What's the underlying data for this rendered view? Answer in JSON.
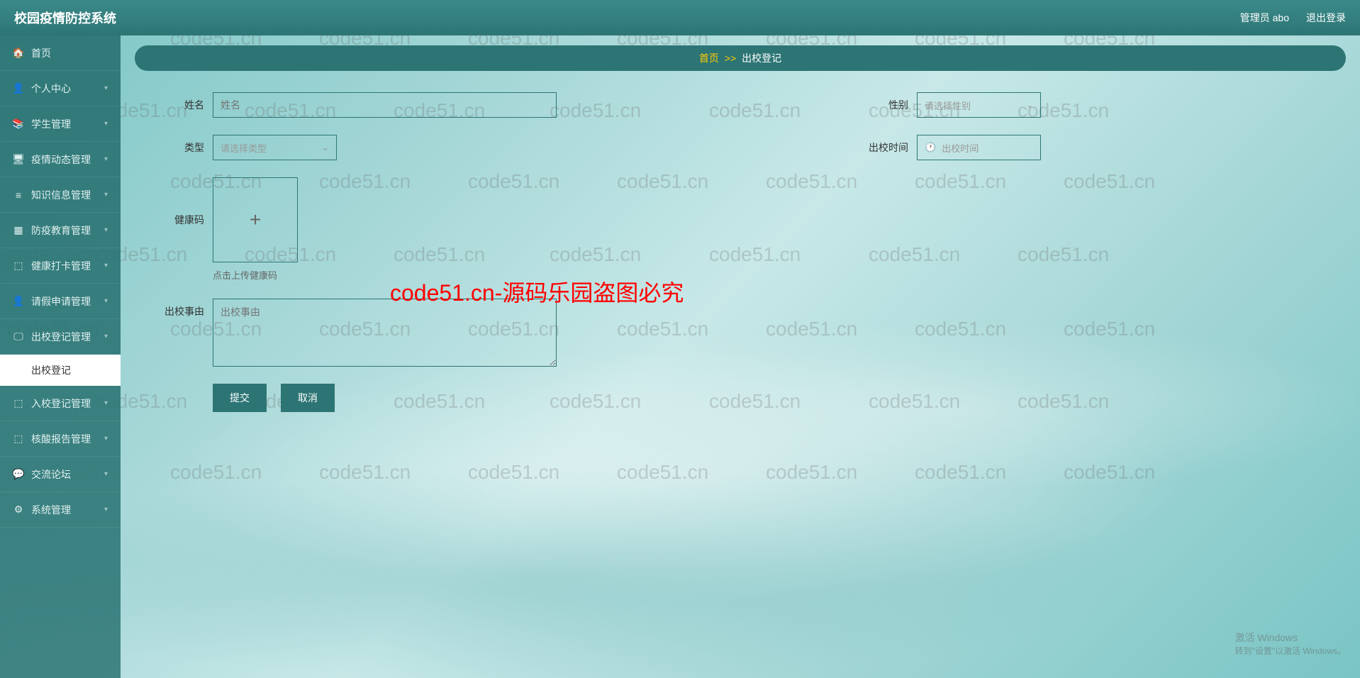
{
  "header": {
    "title": "校园疫情防控系统",
    "user_label": "管理员 abo",
    "logout": "退出登录"
  },
  "sidebar": {
    "items": [
      {
        "icon": "🏠",
        "label": "首页"
      },
      {
        "icon": "👤",
        "label": "个人中心"
      },
      {
        "icon": "📚",
        "label": "学生管理"
      },
      {
        "icon": "🖥",
        "label": "疫情动态管理"
      },
      {
        "icon": "≡",
        "label": "知识信息管理"
      },
      {
        "icon": "▦",
        "label": "防疫教育管理"
      },
      {
        "icon": "⬚",
        "label": "健康打卡管理"
      },
      {
        "icon": "👤",
        "label": "请假申请管理"
      },
      {
        "icon": "🖵",
        "label": "出校登记管理"
      },
      {
        "icon": "⬚",
        "label": "入校登记管理"
      },
      {
        "icon": "⬚",
        "label": "核酸报告管理"
      },
      {
        "icon": "💬",
        "label": "交流论坛"
      },
      {
        "icon": "⚙",
        "label": "系统管理"
      }
    ],
    "active_sub": "出校登记"
  },
  "breadcrumb": {
    "home": "首页",
    "sep": ">>",
    "current": "出校登记"
  },
  "form": {
    "name_label": "姓名",
    "name_placeholder": "姓名",
    "gender_label": "性别",
    "gender_placeholder": "请选择性别",
    "type_label": "类型",
    "type_placeholder": "请选择类型",
    "out_time_label": "出校时间",
    "out_time_placeholder": "出校时间",
    "health_code_label": "健康码",
    "upload_hint": "点击上传健康码",
    "reason_label": "出校事由",
    "reason_placeholder": "出校事由",
    "submit": "提交",
    "cancel": "取消"
  },
  "overlay": {
    "center": "code51.cn-源码乐园盗图必究",
    "watermark": "code51.cn",
    "activate1": "激活 Windows",
    "activate2": "转到\"设置\"以激活 Windows。"
  }
}
